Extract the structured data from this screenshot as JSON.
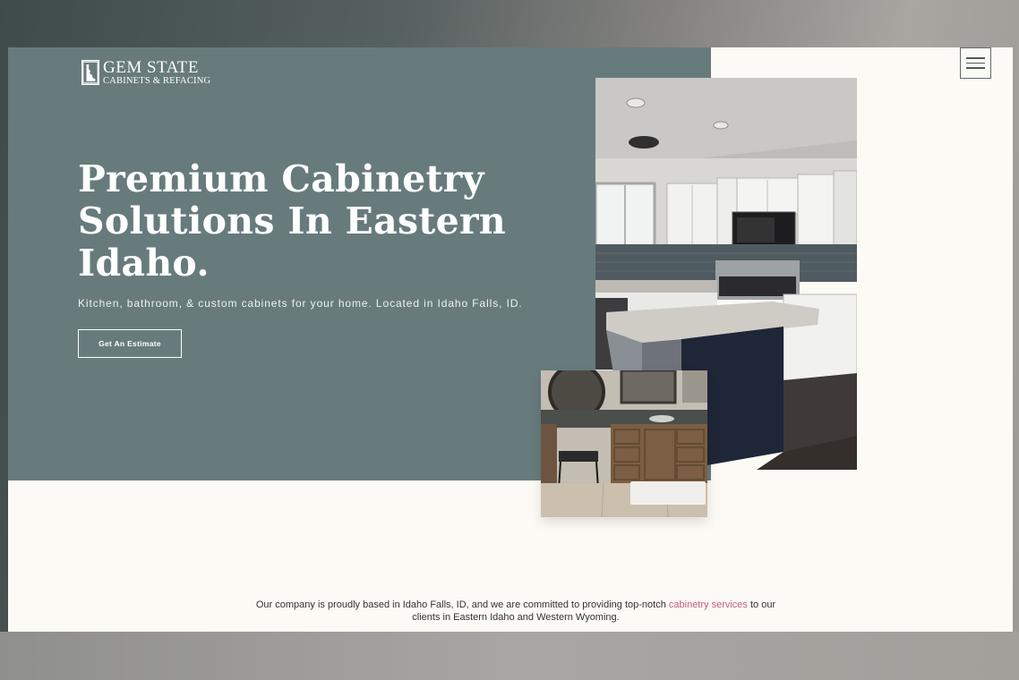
{
  "brand": {
    "title": "GEM STATE",
    "subtitle": "CABINETS & REFACING"
  },
  "nav": {
    "menu_icon": "hamburger-menu-icon"
  },
  "hero": {
    "headline_lines": [
      "Premium Cabinetry",
      "Solutions In Eastern",
      "Idaho."
    ],
    "subtext": "Kitchen, bathroom, & custom cabinets for your home. Located in Idaho Falls, ID.",
    "cta_label": "Get An Estimate"
  },
  "intro": {
    "line1_prefix": "Our company is proudly based in Idaho Falls, ID, and we are committed to providing top-notch ",
    "link_text": "cabinetry services",
    "line1_suffix": " to our",
    "line2": "clients in Eastern Idaho and Western Wyoming."
  },
  "colors": {
    "hero_panel": "#677b7c",
    "page_background": "#fcfaf5",
    "link": "#c2607f"
  }
}
